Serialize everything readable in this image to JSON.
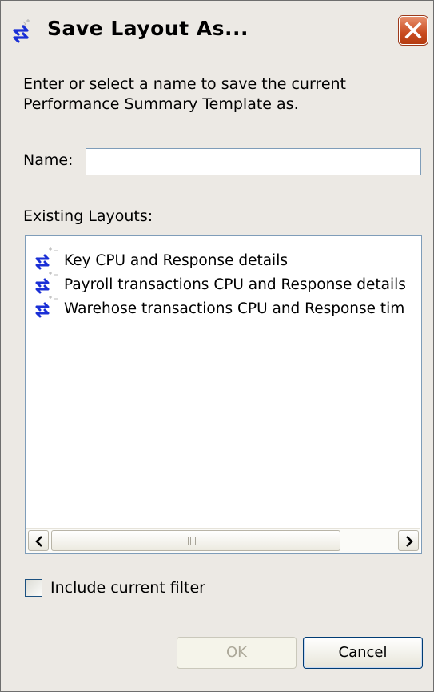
{
  "window": {
    "title": "Save Layout As...",
    "title_icon": "layout-swap-icon",
    "close_icon": "close-icon"
  },
  "instructions": "Enter or select a name to save the current Performance Summary Template as.",
  "name_field": {
    "label": "Name:",
    "value": "",
    "placeholder": ""
  },
  "existing_layouts": {
    "label": "Existing Layouts:",
    "items": [
      {
        "label": "Key CPU and Response details",
        "icon": "layout-swap-icon"
      },
      {
        "label": "Payroll transactions CPU and Response details",
        "icon": "layout-swap-icon"
      },
      {
        "label": "Warehose transactions CPU and Response tim",
        "icon": "layout-swap-icon"
      }
    ],
    "scrollbar_grip": "III"
  },
  "include_filter": {
    "label": "Include current filter",
    "checked": false
  },
  "buttons": {
    "ok": "OK",
    "cancel": "Cancel"
  },
  "colors": {
    "window_bg": "#ece9e4",
    "close_button": "#c94b1f",
    "icon_blue": "#1a2fd6",
    "disabled_text": "#aca899"
  }
}
